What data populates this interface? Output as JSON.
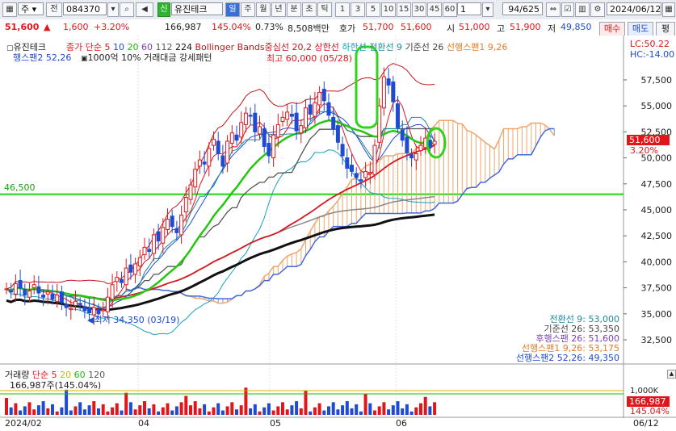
{
  "toolbar": {
    "type_label": "주",
    "prev_label": "전",
    "code_value": "084370",
    "stock_badge": "신",
    "stock_name": "유진테크",
    "periods": [
      "일",
      "주",
      "월",
      "년",
      "분",
      "초",
      "틱"
    ],
    "intervals": [
      "1",
      "3",
      "5",
      "10",
      "15",
      "30",
      "45",
      "60"
    ],
    "interval_value": "1",
    "page_counter": "94/625",
    "date_value": "2024/06/12"
  },
  "quote": {
    "price": "51,600",
    "change": "1,600",
    "change_pct": "+3.20%",
    "volume": "166,987",
    "volume_ratio": "145.04%",
    "turnover_rate": "0.73%",
    "amount": "8,508백만",
    "ask_label": "호가",
    "ask": "51,700",
    "bid": "51,600",
    "open_label": "시",
    "open": "51,000",
    "high_label": "고",
    "high": "51,900",
    "low_label": "저",
    "low": "49,850",
    "buy_label": "매수",
    "sell_label": "매도",
    "eval_label": "평"
  },
  "chart": {
    "name": "유진테크",
    "legend_items": [
      {
        "text": "종가 단순 5",
        "color": "#e0161b"
      },
      {
        "text": "10",
        "color": "#1e4bd2"
      },
      {
        "text": "20",
        "color": "#1fb80d"
      },
      {
        "text": "60",
        "color": "#7a3fb8"
      },
      {
        "text": "112",
        "color": "#555555"
      },
      {
        "text": "224",
        "color": "#111111"
      },
      {
        "text": "Bollinger Bands중심선 20,2",
        "color": "#c8141b"
      },
      {
        "text": "상한선",
        "color": "#c8141b"
      },
      {
        "text": "하한선",
        "color": "#16a0c0"
      },
      {
        "text": "전환선 9",
        "color": "#1b8a9a"
      },
      {
        "text": "기준선 26",
        "color": "#444444"
      },
      {
        "text": "선행스팬1 9,26",
        "color": "#e87c2a"
      }
    ],
    "legend_line2": "행스팬2 52,26",
    "condition_text": "1000억 10% 거래대금 강세패턴",
    "lc": "LC:50.22",
    "hc": "HC:-14.00",
    "high_note": "최고 60,000 (05/28)",
    "low_note": "최저 34,350 (03/19)",
    "support_label": "46,500",
    "price_tag": "51,600",
    "pct_tag": "3.20%",
    "ichimoku_values": [
      {
        "text": "전환선 9: 53,000",
        "color": "#1b8a9a"
      },
      {
        "text": "기준선 26: 53,350",
        "color": "#444444"
      },
      {
        "text": "후행스팬 26: 51,600",
        "color": "#7a3fb8"
      },
      {
        "text": "선행스팬1 9,26: 53,175",
        "color": "#e87c2a"
      },
      {
        "text": "선행스팬2 52,26: 49,350",
        "color": "#1e4bd2"
      }
    ],
    "date_labels": [
      {
        "text": "2024/02",
        "x": "2024-02-01"
      },
      {
        "text": "04",
        "x": "2024-04-01"
      },
      {
        "text": "05",
        "x": "2024-05-02"
      },
      {
        "text": "06",
        "x": "2024-06-03"
      }
    ],
    "last_date": "06/12"
  },
  "volume_panel": {
    "title_parts": [
      {
        "text": "거래량",
        "color": "#222222"
      },
      {
        "text": "단순 5",
        "color": "#e0161b"
      },
      {
        "text": "20",
        "color": "#c7b800"
      },
      {
        "text": "60",
        "color": "#1fb80d"
      },
      {
        "text": "120",
        "color": "#555555"
      }
    ],
    "current": "166,987주(145.04%)",
    "axis_label": "1,000K",
    "value_tag": "166,987",
    "pct_tag": "145.04%"
  },
  "colors": {
    "up": "#e0161b",
    "down": "#1e4bd2",
    "ma20": "#22c70e",
    "support": "#19d712",
    "highlight": "#2fd51b",
    "cloud": "#f0a56a"
  },
  "chart_data": {
    "type": "candlestick",
    "title": "유진테크",
    "y_axis": {
      "min": 30000,
      "max": 60000,
      "ticks": [
        32500,
        35000,
        37500,
        40000,
        42500,
        45000,
        47500,
        50000,
        52500,
        55000,
        57500
      ]
    },
    "support_line": 46500,
    "last_close": 51600,
    "highest": {
      "value": 60000,
      "date": "05/28"
    },
    "lowest": {
      "value": 34350,
      "date": "03/19"
    },
    "closes": [
      37400,
      37100,
      37900,
      37500,
      36800,
      37200,
      37800,
      37000,
      36600,
      37100,
      36400,
      36800,
      36100,
      35600,
      35500,
      36200,
      35900,
      35300,
      35100,
      35600,
      35000,
      35400,
      36600,
      37800,
      38500,
      38000,
      39400,
      39000,
      39800,
      40400,
      41400,
      41000,
      42600,
      42000,
      43300,
      44100,
      43400,
      42800,
      44500,
      46200,
      47400,
      48900,
      49800,
      49400,
      50900,
      51800,
      50400,
      49200,
      51600,
      52400,
      51700,
      53400,
      54300,
      54000,
      52500,
      53000,
      51100,
      50200,
      52200,
      53200,
      53900,
      54400,
      54000,
      52600,
      53100,
      54800,
      54200,
      55300,
      56300,
      55500,
      54100,
      52800,
      51500,
      50200,
      49000,
      48700,
      48100,
      47800,
      48700,
      48600,
      51200,
      55000,
      57800,
      57000,
      55400,
      52900,
      51700,
      50500,
      50000,
      50400,
      51200,
      51900,
      51000,
      51600
    ],
    "volume_unit": "shares",
    "volume_axis_tick": 1000000
  }
}
